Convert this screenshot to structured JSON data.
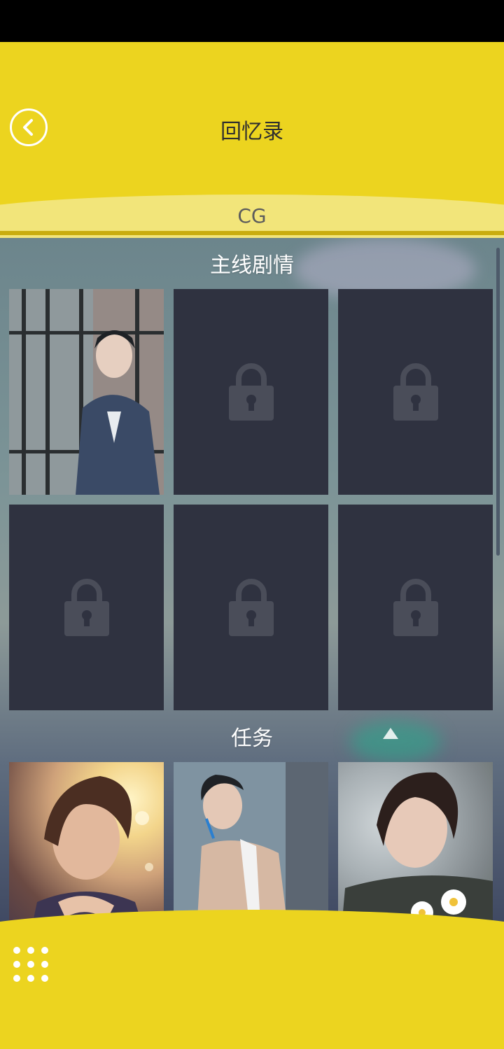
{
  "header": {
    "title": "回忆录",
    "tab": "CG"
  },
  "sections": [
    {
      "title": "主线剧情",
      "cards": [
        {
          "state": "unlocked",
          "art": "man-at-window"
        },
        {
          "state": "locked",
          "icon": "lock-icon"
        },
        {
          "state": "locked",
          "icon": "lock-icon"
        },
        {
          "state": "locked",
          "icon": "lock-icon"
        },
        {
          "state": "locked",
          "icon": "lock-icon"
        },
        {
          "state": "locked",
          "icon": "lock-icon"
        }
      ]
    },
    {
      "title": "任务",
      "cards": [
        {
          "state": "unlocked",
          "art": "man-resting-chin"
        },
        {
          "state": "unlocked",
          "art": "man-brushing-teeth"
        },
        {
          "state": "unlocked",
          "art": "man-with-daisies"
        }
      ]
    }
  ],
  "colors": {
    "header_yellow": "#ecd41f",
    "header_light": "#f2e57a",
    "locked_card": "#2f3240",
    "lock_icon": "#4a4d59"
  }
}
